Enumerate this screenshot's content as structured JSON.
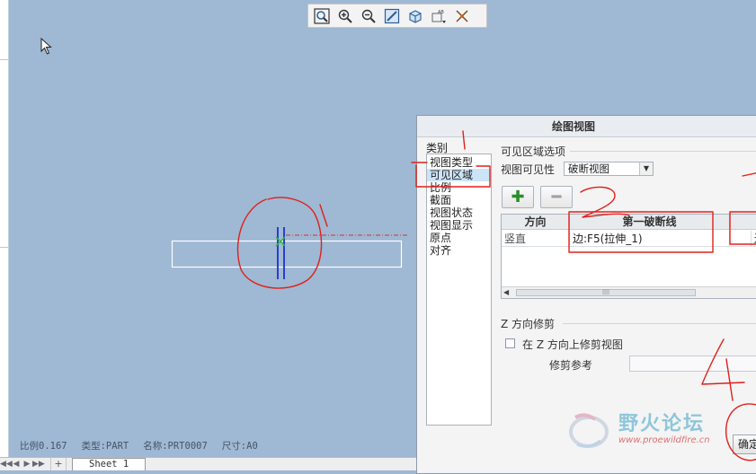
{
  "toolbar": {
    "buttons": [
      "zoom-fit",
      "zoom-in",
      "zoom-out",
      "repaint",
      "view-orientation",
      "named-views",
      "datum-display"
    ]
  },
  "status_bar": {
    "scale": "比例0.167",
    "type": "类型:PART",
    "name": "名称:PRT0007",
    "size": "尺寸:A0"
  },
  "sheet_tabs": {
    "add": "+",
    "sheet": "Sheet 1"
  },
  "dialog": {
    "title": "绘图视图",
    "category_label": "类别",
    "categories": [
      "视图类型",
      "可见区域",
      "比例",
      "截面",
      "视图状态",
      "视图显示",
      "原点",
      "对齐"
    ],
    "selected_category": "可见区域",
    "visible_area_section": "可见区域选项",
    "visibility_label": "视图可见性",
    "visibility_value": "破断视图",
    "table_headers": [
      "方向",
      "第一破断线"
    ],
    "table_row": [
      "竖直",
      "边:F5(拉伸_1)"
    ],
    "table_row_partial": "边",
    "z_clip_section": "Z 方向修剪",
    "z_clip_checkbox_label": "在 Z 方向上修剪视图",
    "clip_reference_label": "修剪参考",
    "ok_label": "确定"
  },
  "watermark": {
    "title": "野火论坛",
    "url": "www.proewildfire.cn"
  },
  "colors": {
    "viewport_bg": "#9fb8d3",
    "annotation_red": "#e0201a",
    "break_line_blue": "#2a3fcf",
    "selection_highlight": "#cce4f7"
  }
}
